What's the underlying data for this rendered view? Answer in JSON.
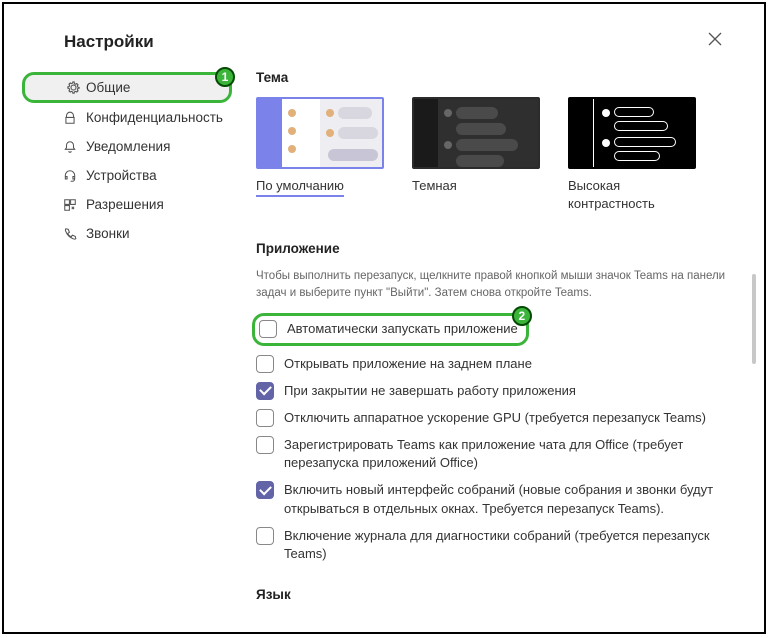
{
  "header": {
    "title": "Настройки"
  },
  "sidebar": {
    "items": [
      {
        "label": "Общие"
      },
      {
        "label": "Конфиденциальность"
      },
      {
        "label": "Уведомления"
      },
      {
        "label": "Устройства"
      },
      {
        "label": "Разрешения"
      },
      {
        "label": "Звонки"
      }
    ]
  },
  "theme": {
    "title": "Тема",
    "options": [
      {
        "label": "По умолчанию"
      },
      {
        "label": "Темная"
      },
      {
        "label": "Высокая контрастность"
      }
    ]
  },
  "app": {
    "title": "Приложение",
    "hint": "Чтобы выполнить перезапуск, щелкните правой кнопкой мыши значок Teams на панели задач и выберите пункт \"Выйти\". Затем снова откройте Teams.",
    "checks": [
      {
        "label": "Автоматически запускать приложение",
        "checked": false
      },
      {
        "label": "Открывать приложение на заднем плане",
        "checked": false
      },
      {
        "label": "При закрытии не завершать работу приложения",
        "checked": true
      },
      {
        "label": "Отключить аппаратное ускорение GPU (требуется перезапуск Teams)",
        "checked": false
      },
      {
        "label": "Зарегистрировать Teams как приложение чата для Office (требует перезапуска приложений Office)",
        "checked": false
      },
      {
        "label": "Включить новый интерфейс собраний (новые собрания и звонки будут открываться в отдельных окнах. Требуется перезапуск Teams).",
        "checked": true
      },
      {
        "label": "Включение журнала для диагностики собраний (требуется перезапуск Teams)",
        "checked": false
      }
    ]
  },
  "lang": {
    "title": "Язык"
  },
  "badges": {
    "b1": "1",
    "b2": "2"
  }
}
